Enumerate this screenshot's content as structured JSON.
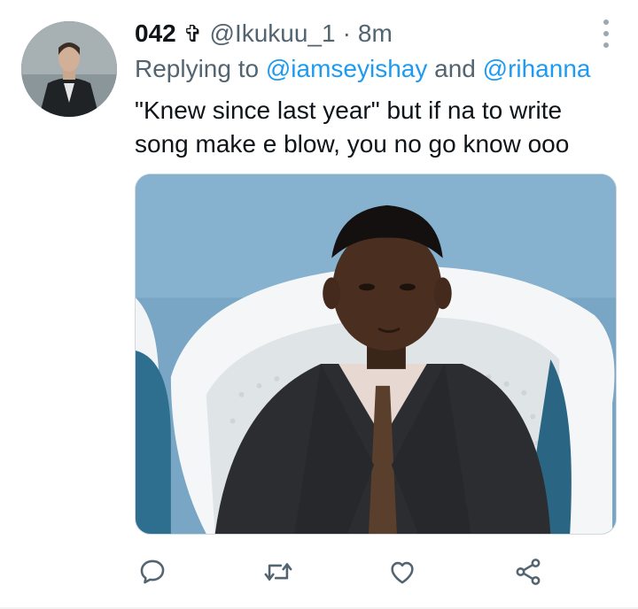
{
  "tweet": {
    "display_name": "042",
    "name_glyph": "✞",
    "handle": "@Ikukuu_1",
    "separator": "·",
    "time": "8m",
    "replying_prefix": "Replying to ",
    "replying_to": [
      "@iamseyishay",
      "@rihanna"
    ],
    "replying_joiner": " and ",
    "text_line1": "\"Knew since last year\" but if na to write",
    "text_line2": "song make e blow, you no go know ooo"
  },
  "actions": {
    "icons": [
      "reply-icon",
      "retweet-icon",
      "like-icon",
      "share-icon"
    ]
  },
  "colors": {
    "text": "#0f1419",
    "secondary": "#536471",
    "link": "#1d9bf0",
    "icon": "#536471"
  }
}
